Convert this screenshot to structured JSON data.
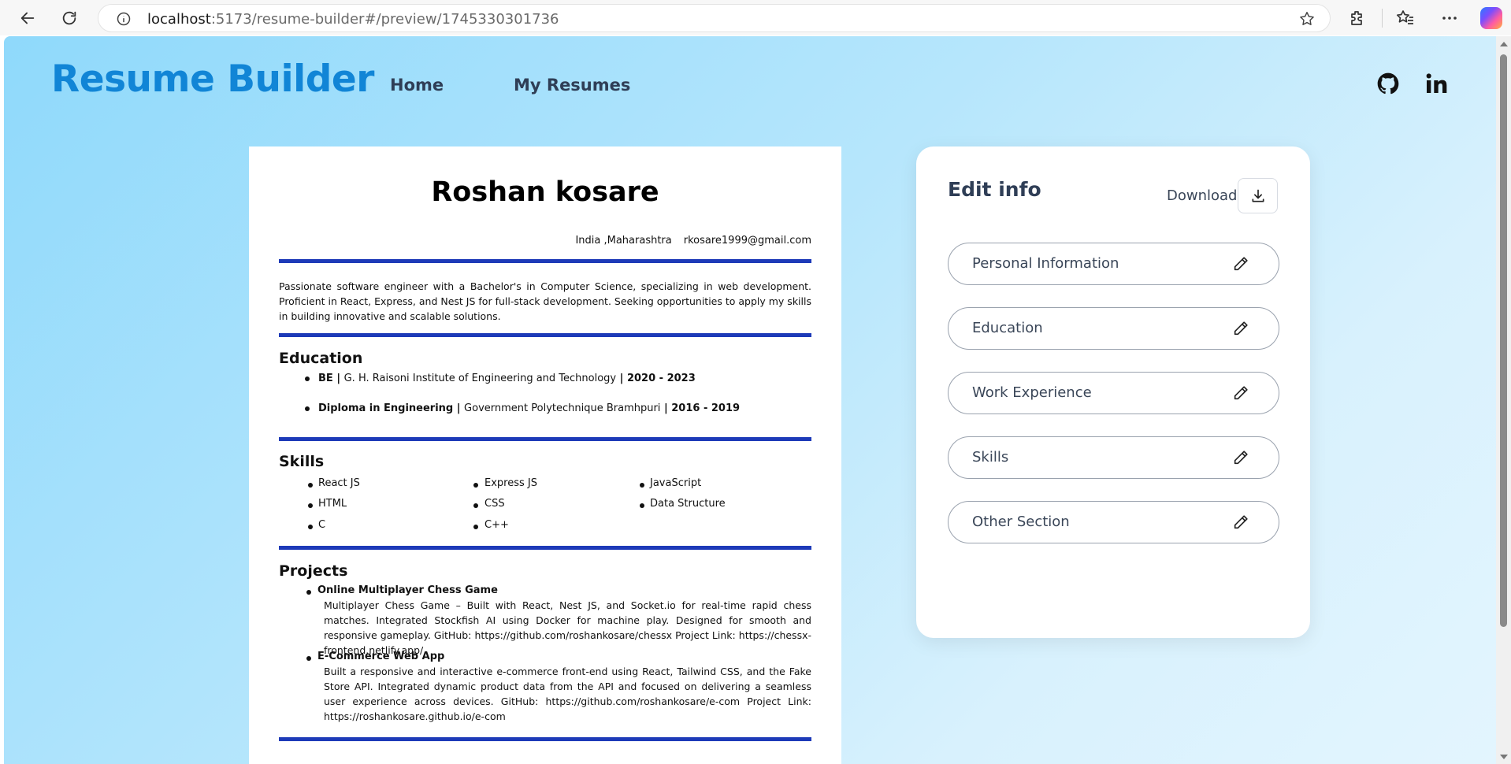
{
  "browser": {
    "url_host": "localhost",
    "url_rest": ":5173/resume-builder#/preview/1745330301736"
  },
  "header": {
    "brand": "Resume Builder",
    "nav": [
      "Home",
      "My Resumes"
    ],
    "icons": [
      "github-icon",
      "linkedin-icon"
    ]
  },
  "resume": {
    "name": "Roshan kosare",
    "location": "India ,Maharashtra",
    "email": "rkosare1999@gmail.com",
    "summary": "Passionate software engineer with a Bachelor's in Computer Science, specializing in web development. Proficient in React, Express, and Nest JS for full-stack development. Seeking opportunities to apply my skills in building innovative and scalable solutions.",
    "education_heading": "Education",
    "education": [
      {
        "degree": "BE",
        "institute": "G. H. Raisoni Institute of Engineering and Technology",
        "years": "2020 - 2023"
      },
      {
        "degree": "Diploma in Engineering",
        "institute": "Government Polytechnique Bramhpuri",
        "years": "2016 - 2019"
      }
    ],
    "skills_heading": "Skills",
    "skills": [
      "React JS",
      "Express JS",
      "JavaScript",
      "HTML",
      "CSS",
      "Data Structure",
      "C",
      "C++"
    ],
    "projects_heading": "Projects",
    "projects": [
      {
        "title": "Online Multiplayer Chess Game",
        "description": "Multiplayer Chess Game – Built with React, Nest JS, and Socket.io for real-time rapid chess matches. Integrated Stockfish AI using Docker for machine play. Designed for smooth and responsive gameplay. GitHub: https://github.com/roshankosare/chessx Project Link: https://chessx-frontend.netlify.app/"
      },
      {
        "title": "E-Commerce Web App",
        "description": "Built a responsive and interactive e-commerce front-end using React, Tailwind CSS, and the Fake Store API. Integrated dynamic product data from the API and focused on delivering a seamless user experience across devices. GitHub: https://github.com/roshankosare/e-com Project Link: https://roshankosare.github.io/e-com"
      }
    ]
  },
  "panel": {
    "title": "Edit info",
    "download_label": "Download",
    "sections": [
      "Personal Information",
      "Education",
      "Work Experience",
      "Skills",
      "Other Section"
    ]
  },
  "colors": {
    "brand": "#1185d6",
    "rule": "#1d3ab8",
    "nav_text": "#2f3e56"
  }
}
